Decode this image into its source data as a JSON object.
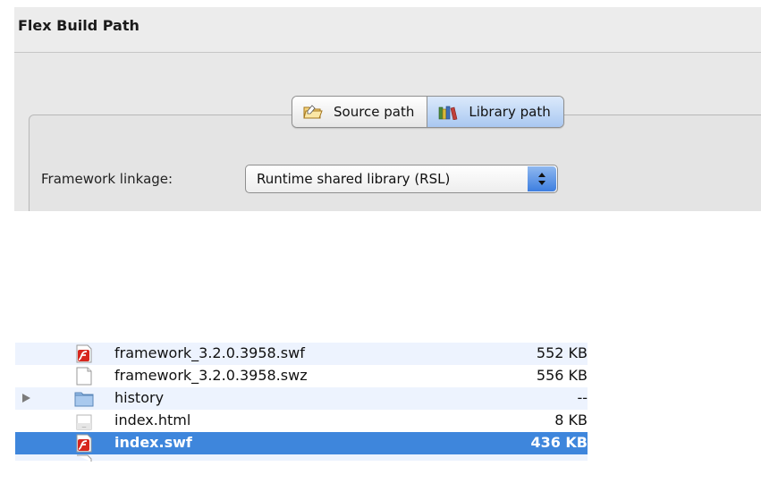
{
  "dialog": {
    "title": "Flex Build Path",
    "tabs": [
      {
        "label": "Source path",
        "icon": "folder-source-icon",
        "active": false
      },
      {
        "label": "Library path",
        "icon": "books-library-icon",
        "active": true
      }
    ],
    "linkage_label": "Framework linkage:",
    "linkage_value": "Runtime shared library (RSL)"
  },
  "files": [
    {
      "name": "framework_3.2.0.3958.swf",
      "size": "552 KB",
      "icon": "flash-swf-icon",
      "folder": false,
      "selected": false
    },
    {
      "name": "framework_3.2.0.3958.swz",
      "size": "556 KB",
      "icon": "document-icon",
      "folder": false,
      "selected": false
    },
    {
      "name": "history",
      "size": "--",
      "icon": "folder-icon",
      "folder": true,
      "selected": false
    },
    {
      "name": "index.html",
      "size": "8 KB",
      "icon": "html-file-icon",
      "folder": false,
      "selected": false
    },
    {
      "name": "index.swf",
      "size": "436 KB",
      "icon": "flash-swf-icon",
      "folder": false,
      "selected": true
    }
  ],
  "colors": {
    "selection": "#3e86dc",
    "alt_row": "#edf3fe",
    "active_tab": "#a9c8f1"
  }
}
